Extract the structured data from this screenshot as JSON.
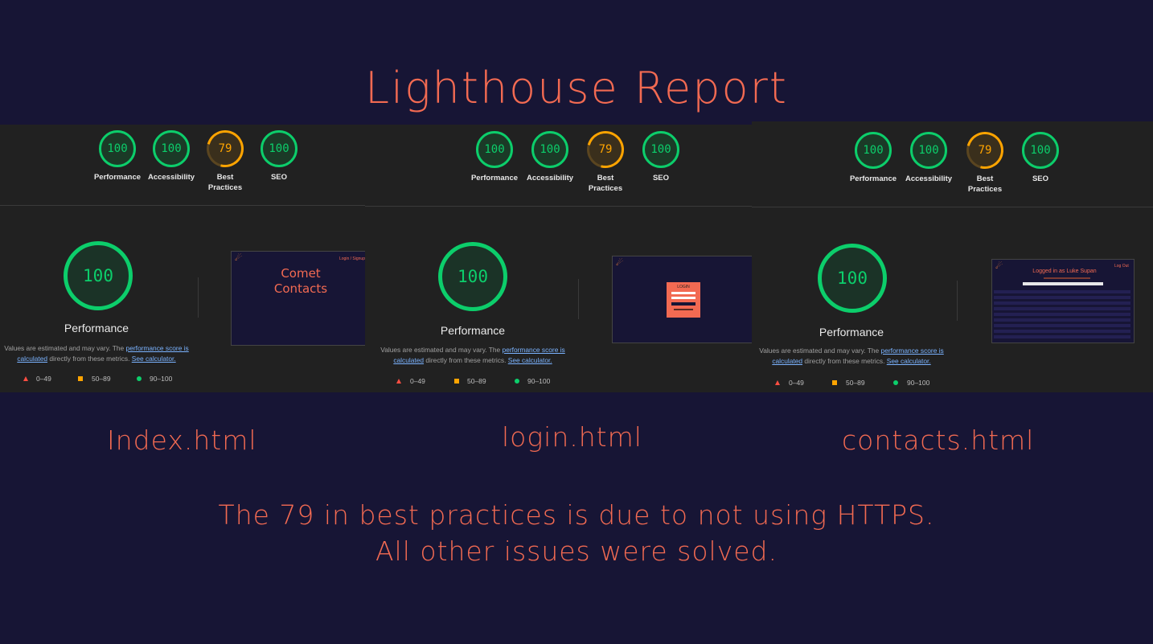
{
  "title": "Lighthouse Report",
  "reports": [
    {
      "page_label": "Index.html",
      "scores": [
        {
          "label": "Performance",
          "value": "100"
        },
        {
          "label": "Accessibility",
          "value": "100"
        },
        {
          "label": "Best Practices",
          "value": "79"
        },
        {
          "label": "SEO",
          "value": "100"
        }
      ],
      "performance": {
        "value": "100",
        "label": "Performance"
      },
      "preview": {
        "heading": "Comet Contacts",
        "nav": "Login / Signup"
      }
    },
    {
      "page_label": "login.html",
      "scores": [
        {
          "label": "Performance",
          "value": "100"
        },
        {
          "label": "Accessibility",
          "value": "100"
        },
        {
          "label": "Best Practices",
          "value": "79"
        },
        {
          "label": "SEO",
          "value": "100"
        }
      ],
      "performance": {
        "value": "100",
        "label": "Performance"
      },
      "preview": {
        "heading": "LOGIN"
      }
    },
    {
      "page_label": "contacts.html",
      "scores": [
        {
          "label": "Performance",
          "value": "100"
        },
        {
          "label": "Accessibility",
          "value": "100"
        },
        {
          "label": "Best Practices",
          "value": "79"
        },
        {
          "label": "SEO",
          "value": "100"
        }
      ],
      "performance": {
        "value": "100",
        "label": "Performance"
      },
      "preview": {
        "heading": "Logged in as Luke Supan",
        "nav": "Log Out"
      }
    }
  ],
  "description": {
    "prefix": "Values are estimated and may vary. The ",
    "link1": "performance score is calculated",
    "middle": " directly from these metrics. ",
    "link2": "See calculator."
  },
  "legend": {
    "red": "0–49",
    "orange": "50–89",
    "green": "90–100"
  },
  "colors": {
    "background": "#171535",
    "accent": "#f26a52",
    "pass": "#0cce6b",
    "average": "#ffa400",
    "fail": "#ff4e42"
  },
  "note": {
    "line1": "The 79 in best practices is due to not using HTTPS.",
    "line2": "All other issues were solved."
  }
}
